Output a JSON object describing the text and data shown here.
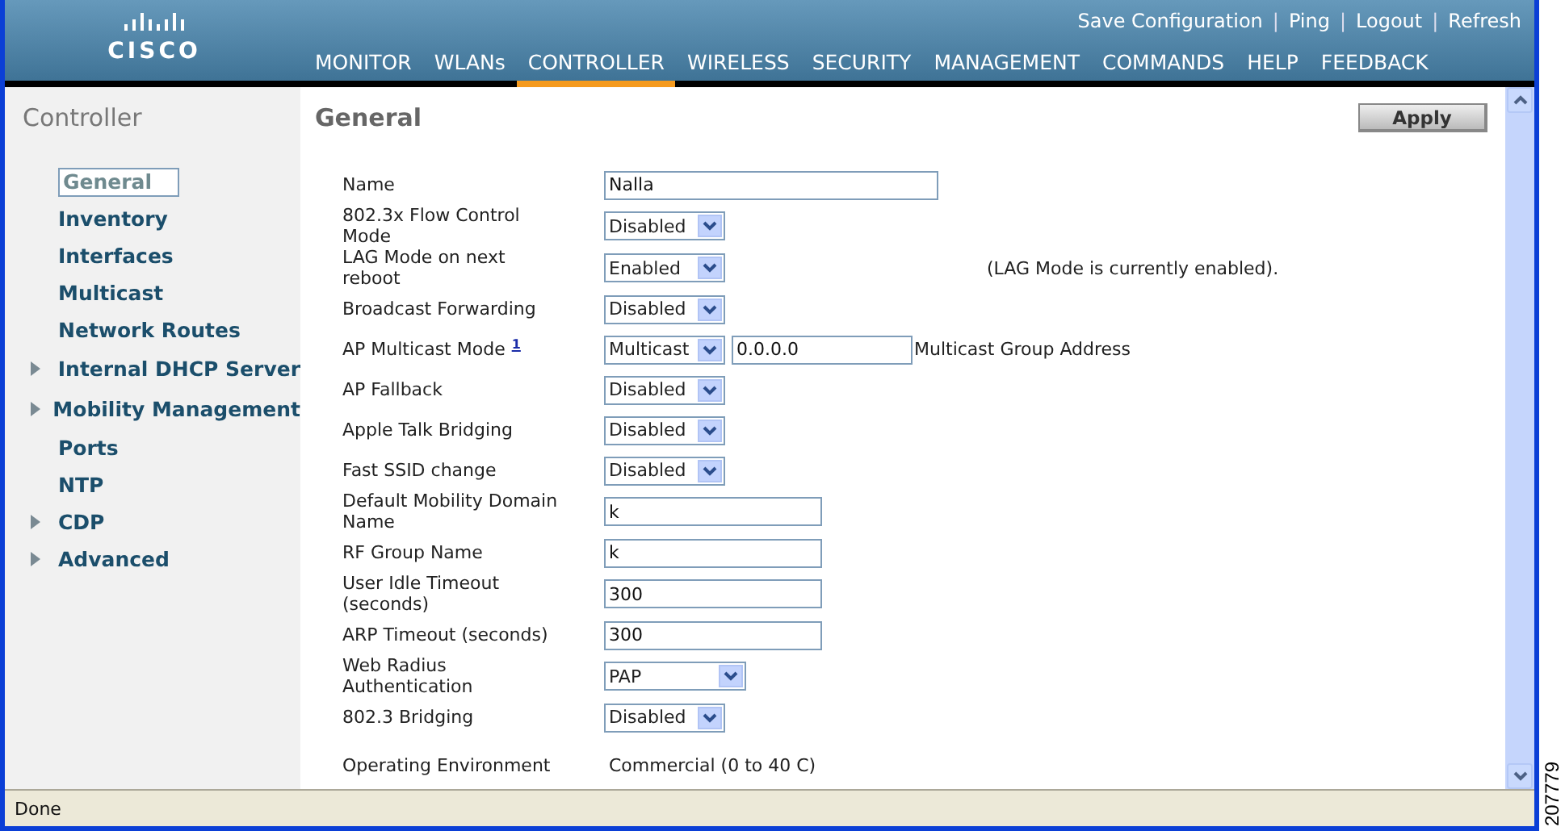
{
  "header": {
    "logo_text": "CISCO",
    "links": [
      "Save Configuration",
      "Ping",
      "Logout",
      "Refresh"
    ],
    "separator": "|",
    "nav": [
      {
        "label": "MONITOR",
        "selected": false
      },
      {
        "label": "WLANs",
        "selected": false
      },
      {
        "label": "CONTROLLER",
        "selected": true
      },
      {
        "label": "WIRELESS",
        "selected": false
      },
      {
        "label": "SECURITY",
        "selected": false
      },
      {
        "label": "MANAGEMENT",
        "selected": false
      },
      {
        "label": "COMMANDS",
        "selected": false
      },
      {
        "label": "HELP",
        "selected": false
      },
      {
        "label": "FEEDBACK",
        "selected": false
      }
    ]
  },
  "sidebar": {
    "title": "Controller",
    "items": [
      {
        "label": "General",
        "selected": true,
        "expandable": false
      },
      {
        "label": "Inventory",
        "selected": false,
        "expandable": false
      },
      {
        "label": "Interfaces",
        "selected": false,
        "expandable": false
      },
      {
        "label": "Multicast",
        "selected": false,
        "expandable": false
      },
      {
        "label": "Network Routes",
        "selected": false,
        "expandable": false
      },
      {
        "label": "Internal DHCP Server",
        "selected": false,
        "expandable": true
      },
      {
        "label": "Mobility Management",
        "selected": false,
        "expandable": true
      },
      {
        "label": "Ports",
        "selected": false,
        "expandable": false
      },
      {
        "label": "NTP",
        "selected": false,
        "expandable": false
      },
      {
        "label": "CDP",
        "selected": false,
        "expandable": true
      },
      {
        "label": "Advanced",
        "selected": false,
        "expandable": true
      }
    ]
  },
  "main": {
    "title": "General",
    "apply_button": "Apply",
    "rows": [
      {
        "kind": "text",
        "label": "Name",
        "value": "Nalla",
        "wide": true
      },
      {
        "kind": "select",
        "label": "802.3x Flow Control Mode",
        "value": "Disabled"
      },
      {
        "kind": "select",
        "label": "LAG Mode on next reboot",
        "value": "Enabled",
        "note": "(LAG Mode is currently enabled)."
      },
      {
        "kind": "select",
        "label": "Broadcast Forwarding",
        "value": "Disabled"
      },
      {
        "kind": "select",
        "label": "AP Multicast Mode",
        "footnote": "1",
        "value": "Multicast",
        "field_value": "0.0.0.0",
        "field_label": "Multicast Group Address"
      },
      {
        "kind": "select",
        "label": "AP Fallback",
        "value": "Disabled"
      },
      {
        "kind": "select",
        "label": "Apple Talk Bridging",
        "value": "Disabled"
      },
      {
        "kind": "select",
        "label": "Fast SSID change",
        "value": "Disabled"
      },
      {
        "kind": "text",
        "label": "Default Mobility Domain Name",
        "value": "k"
      },
      {
        "kind": "text",
        "label": "RF Group Name",
        "value": "k"
      },
      {
        "kind": "text",
        "label": "User Idle Timeout (seconds)",
        "value": "300"
      },
      {
        "kind": "text",
        "label": "ARP Timeout (seconds)",
        "value": "300"
      },
      {
        "kind": "select",
        "label": "Web Radius Authentication",
        "value": "PAP",
        "wide": true
      },
      {
        "kind": "select",
        "label": "802.3 Bridging",
        "value": "Disabled"
      },
      {
        "kind": "static",
        "label": "Operating Environment",
        "value": "Commercial (0 to 40 C)"
      }
    ]
  },
  "status_bar": {
    "text": "Done"
  },
  "figure_id": "207779"
}
